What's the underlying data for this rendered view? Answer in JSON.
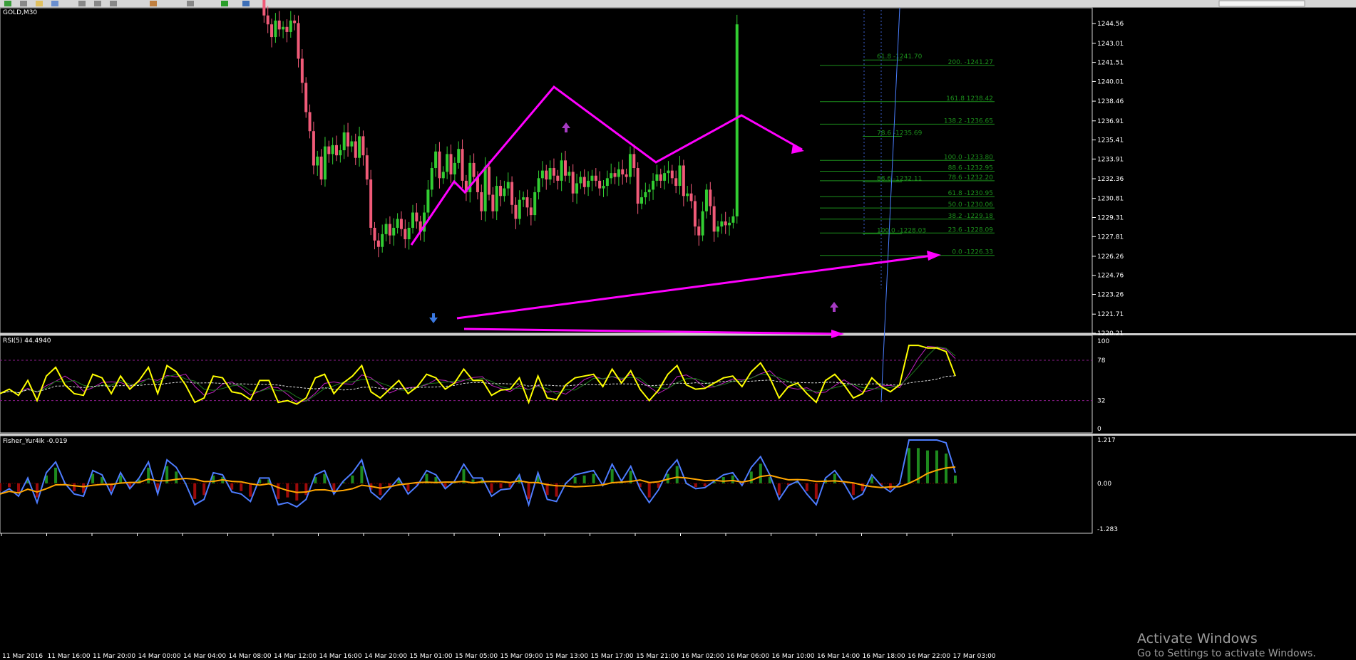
{
  "toolbar": {
    "visible": true
  },
  "watermark": {
    "line1": "Activate Windows",
    "line2": "Go to Settings to activate Windows."
  },
  "colors": {
    "background": "#000000",
    "bull_candle": "#32CD32",
    "bear_candle": "#F05A78",
    "drawing": "#FF00FF",
    "fib": "#1C8F1C",
    "rsi": "#FFFF00",
    "fisher_blue": "#4D7CFF",
    "fisher_orange": "#FFA500",
    "hist_pos": "#1E8A1E",
    "hist_neg": "#9B0A0A",
    "axis_text": "#FFFFFF",
    "grid_dotted": "#8B1C8B"
  },
  "chart_data": [
    {
      "type": "candlestick",
      "title": "GOLD,M30",
      "symbol": "GOLD",
      "timeframe": "M30",
      "ylim": [
        1220.21,
        1245.8
      ],
      "y_ticks": [
        "1244.56",
        "1243.01",
        "1241.51",
        "1240.01",
        "1238.46",
        "1236.91",
        "1235.41",
        "1233.91",
        "1232.36",
        "1230.81",
        "1229.31",
        "1227.81",
        "1226.26",
        "1224.76",
        "1223.26",
        "1221.71",
        "1220.21"
      ],
      "x_ticks": [
        "11 Mar 2016",
        "11 Mar 16:00",
        "11 Mar 20:00",
        "14 Mar 00:00",
        "14 Mar 04:00",
        "14 Mar 08:00",
        "14 Mar 12:00",
        "14 Mar 16:00",
        "14 Mar 20:00",
        "15 Mar 01:00",
        "15 Mar 05:00",
        "15 Mar 09:00",
        "15 Mar 13:00",
        "15 Mar 17:00",
        "15 Mar 21:00",
        "16 Mar 02:00",
        "16 Mar 06:00",
        "16 Mar 10:00",
        "16 Mar 14:00",
        "16 Mar 18:00",
        "16 Mar 22:00",
        "17 Mar 03:00"
      ],
      "candles_close": [
        1246.8,
        1245.2,
        1244.5,
        1243.5,
        1244.8,
        1244.1,
        1244.3,
        1243.9,
        1244.8,
        1244.6,
        1241.8,
        1239.9,
        1237.6,
        1236.1,
        1233.4,
        1234.1,
        1232.3,
        1234.9,
        1234.3,
        1235.0,
        1234.2,
        1234.6,
        1236.0,
        1234.9,
        1235.3,
        1234.0,
        1235.7,
        1234.2,
        1232.3,
        1228.5,
        1227.5,
        1227.0,
        1228.0,
        1228.8,
        1227.9,
        1228.5,
        1229.2,
        1228.4,
        1227.6,
        1228.5,
        1229.7,
        1229.0,
        1228.2,
        1229.7,
        1231.5,
        1233.2,
        1234.5,
        1232.4,
        1232.9,
        1234.3,
        1232.7,
        1233.6,
        1234.7,
        1232.2,
        1231.3,
        1233.6,
        1232.5,
        1231.3,
        1229.8,
        1233.3,
        1231.1,
        1229.8,
        1231.8,
        1231.0,
        1231.6,
        1232.1,
        1230.3,
        1229.2,
        1230.7,
        1230.9,
        1230.1,
        1229.5,
        1231.3,
        1232.4,
        1233.0,
        1232.3,
        1233.2,
        1232.6,
        1232.2,
        1233.8,
        1232.6,
        1232.9,
        1231.2,
        1232.0,
        1232.5,
        1231.7,
        1232.2,
        1232.6,
        1232.2,
        1231.6,
        1231.8,
        1232.4,
        1232.8,
        1232.5,
        1233.1,
        1232.7,
        1232.5,
        1234.3,
        1233.2,
        1230.4,
        1230.9,
        1231.3,
        1231.5,
        1232.2,
        1232.7,
        1232.2,
        1232.8,
        1233.0,
        1232.4,
        1231.8,
        1233.4,
        1231.0,
        1231.2,
        1230.6,
        1228.6,
        1227.9,
        1229.8,
        1231.5,
        1230.2,
        1228.2,
        1228.6,
        1229.0,
        1228.7,
        1228.9,
        1229.4,
        1244.5
      ],
      "fibonacci_left": [
        {
          "label": "61.8 -1241.70"
        },
        {
          "label": "78.6 -1235.69"
        },
        {
          "label": "88.6 -1232.11"
        },
        {
          "label": "100.0 -1228.03"
        }
      ],
      "fibonacci_right": [
        {
          "label": "200. -1241.27"
        },
        {
          "label": "161.8 1238.42"
        },
        {
          "label": "138.2 -1236.65"
        },
        {
          "label": "100.0 -1233.80"
        },
        {
          "label": "88.6 -1232.95"
        },
        {
          "label": "78.6 -1232.20"
        },
        {
          "label": "61.8 -1230.95"
        },
        {
          "label": "50.0 -1230.06"
        },
        {
          "label": "38.2 -1229.18"
        },
        {
          "label": "23.6 -1228.09"
        },
        {
          "label": "0.0 -1226.33"
        }
      ]
    },
    {
      "type": "line",
      "title": "RSI(5) 44.4940",
      "ylim": [
        0,
        100
      ],
      "y_ticks": [
        "100",
        "78",
        "32",
        "0"
      ],
      "levels": [
        78,
        32
      ],
      "series": [
        {
          "name": "RSI(5) 44.4940",
          "values": [
            40,
            45,
            38,
            55,
            32,
            60,
            70,
            50,
            40,
            38,
            62,
            58,
            40,
            60,
            45,
            55,
            70,
            40,
            72,
            65,
            50,
            30,
            35,
            60,
            58,
            42,
            40,
            33,
            55,
            55,
            30,
            32,
            28,
            35,
            58,
            62,
            40,
            52,
            60,
            72,
            42,
            35,
            45,
            55,
            40,
            48,
            62,
            58,
            45,
            52,
            68,
            55,
            55,
            38,
            44,
            45,
            58,
            30,
            60,
            35,
            33,
            50,
            58,
            60,
            62,
            48,
            68,
            52,
            66,
            45,
            32,
            44,
            62,
            72,
            50,
            45,
            46,
            52,
            58,
            60,
            48,
            65,
            75,
            58,
            35,
            48,
            52,
            40,
            30,
            55,
            62,
            50,
            35,
            40,
            58,
            48,
            42,
            50,
            95,
            95,
            92,
            92,
            88,
            60
          ]
        }
      ]
    },
    {
      "type": "line",
      "title": "Fisher_Yur4ik -0.019",
      "ylim": [
        -1.283,
        1.217
      ],
      "y_ticks": [
        "1.217",
        "0.00",
        "-1.283"
      ],
      "series": [
        {
          "name": "Fisher_Yur4ik -0.019"
        }
      ]
    }
  ]
}
